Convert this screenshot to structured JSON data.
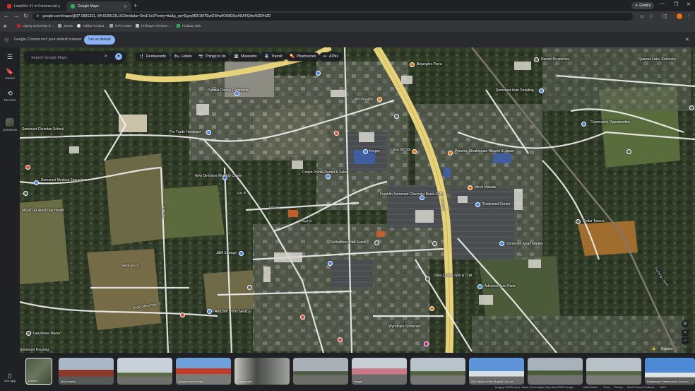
{
  "browser": {
    "tabs": [
      {
        "label": "LoopNet: #1 in Commercial Re...",
        "active": false
      },
      {
        "label": "Google Maps",
        "active": true
      }
    ],
    "gemini_label": "Gemini",
    "url": "google.com/maps/@37.0891331,-84.6199128,1013m/data=!3m1!1e3?entry=ttu&g_ep=EgoyMDI1MTEwOS4wIKXMDSoASAFQAw%3D%3D",
    "bookmarks": [
      "Liberty University (F...",
      "Jaredc",
      "Adobe Acrobat",
      "PrPro class",
      "Prelinger Archives ...",
      "Pixabay web"
    ],
    "infobar_message": "Google Chrome isn't your default browser",
    "set_default_label": "Set as default"
  },
  "rail": {
    "saved_label": "Saved",
    "recents_label": "Recents",
    "recent_place_label": "Somerset",
    "get_app_label": "Get app"
  },
  "search": {
    "placeholder": "Search Google Maps"
  },
  "chips": [
    {
      "label": "Restaurants",
      "icon": "fork-knife-icon",
      "glyph": "🍴"
    },
    {
      "label": "Hotels",
      "icon": "bed-icon",
      "glyph": "🛏"
    },
    {
      "label": "Things to do",
      "icon": "camera-icon",
      "glyph": "📷"
    },
    {
      "label": "Museums",
      "icon": "museum-icon",
      "glyph": "🏛"
    },
    {
      "label": "Transit",
      "icon": "train-icon",
      "glyph": "🚆"
    },
    {
      "label": "Pharmacies",
      "icon": "pharmacy-icon",
      "glyph": "💊"
    },
    {
      "label": "ATMs",
      "icon": "more-icon",
      "glyph": "•••"
    }
  ],
  "map_labels": [
    "Bojangles Pizza",
    "Hansel Properties",
    "Queens Lake, Kentucky",
    "Pulaski County Commons",
    "Somerset Auto Detailing",
    "McDonald's",
    "Pro Trade Hardware",
    "Somerset Christian School",
    "Community Opportunities",
    "Pimento Steakhouse Hibachi & Japan",
    "Kroger",
    "Casa del Sol",
    "New Direction Worship Center",
    "Crown Pointe Rental & Sales",
    "Somerset Medical Specialists",
    "Mirch Masala",
    "Franklin Somerset Chevrolet Buick GMC",
    "Tradewind Center",
    "MENTOR Adult Day Health",
    "Somerset Asian Market",
    "Cedar Towers",
    "Reflections Hair Salon",
    "J&M Storage",
    "Dairy Queen Grill & Chill",
    "Advance Auto Parts",
    "AmCare Home Medical",
    "Greystone Manor",
    "Wyndham Somerset",
    "Somerset Housing",
    "Fishing Creek",
    "Bogle Office Park Dr",
    "Medicare Dr",
    "Fuller Rd",
    "W Hwy 80",
    "Todd St",
    "Floyd St",
    "Loy St",
    "S Hwy 27"
  ],
  "map_controls": {
    "explore_label": "Explore"
  },
  "photos": [
    {
      "caption": "Layers"
    },
    {
      "caption": "McDonald's"
    },
    {
      "caption": ""
    },
    {
      "caption": "Advance Auto Parts"
    },
    {
      "caption": "Greenhouse"
    },
    {
      "caption": ""
    },
    {
      "caption": "Kroger"
    },
    {
      "caption": ""
    },
    {
      "caption": "Old Fashion Faith Baptist Church"
    },
    {
      "caption": ""
    },
    {
      "caption": ""
    },
    {
      "caption": "Bridgetown Pentecostal Church C..."
    }
  ],
  "footer": {
    "attribution": "Imagery ©2025 Airbus, Maxar Technologies, Map data ©2025 Google",
    "region": "United States",
    "terms": "Terms",
    "privacy": "Privacy",
    "feedback": "Send Product Feedback",
    "scale": "200 ft"
  }
}
